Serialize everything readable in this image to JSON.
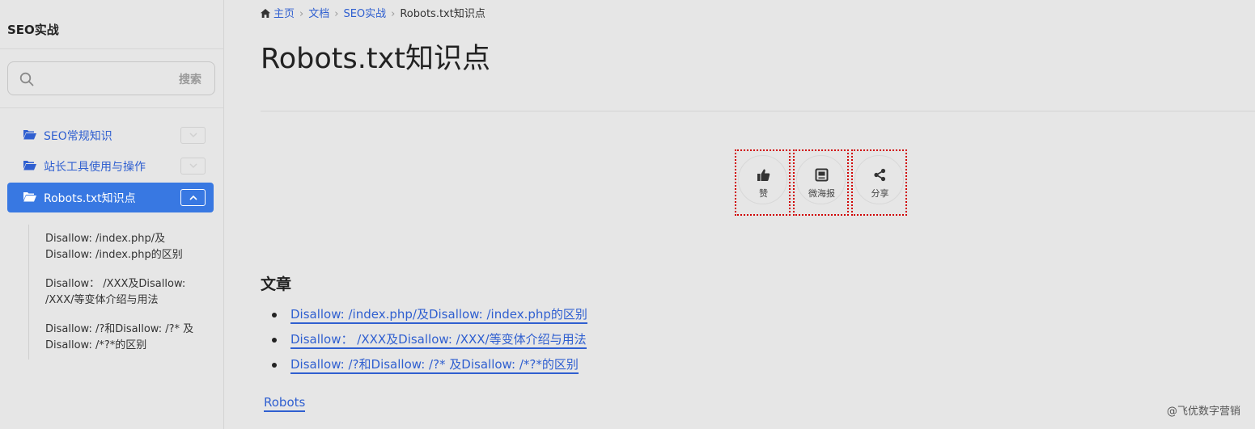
{
  "sidebar": {
    "title": "SEO实战",
    "search": {
      "placeholder": "",
      "button_label": "搜索"
    },
    "items": [
      {
        "label": "SEO常规知识",
        "icon": "folder-open-icon",
        "expanded": false
      },
      {
        "label": "站长工具使用与操作",
        "icon": "folder-open-icon",
        "expanded": false
      },
      {
        "label": "Robots.txt知识点",
        "icon": "folder-open-icon",
        "expanded": true
      }
    ],
    "subitems": [
      {
        "line1": "Disallow: /index.php/及",
        "line2": "Disallow: /index.php的区别"
      },
      {
        "line1": "Disallow： /XXX及Disallow:",
        "line2": "/XXX/等变体介绍与用法"
      },
      {
        "line1": "Disallow: /?和Disallow: /?* 及",
        "line2": "Disallow: /*?*的区别"
      }
    ]
  },
  "breadcrumb": {
    "home": "主页",
    "docs": "文档",
    "section": "SEO实战",
    "current": "Robots.txt知识点"
  },
  "page": {
    "title": "Robots.txt知识点"
  },
  "actions": [
    {
      "label": "赞",
      "icon": "thumbs-up-icon"
    },
    {
      "label": "微海报",
      "icon": "poster-icon"
    },
    {
      "label": "分享",
      "icon": "share-icon"
    }
  ],
  "articles": {
    "heading": "文章",
    "items": [
      "Disallow: /index.php/及Disallow: /index.php的区别",
      "Disallow： /XXX及Disallow: /XXX/等变体介绍与用法",
      "Disallow: /?和Disallow: /?* 及Disallow: /*?*的区别"
    ]
  },
  "tag": "Robots",
  "watermark": "@飞优数字营销",
  "colors": {
    "accent": "#3878e2",
    "link": "#2f5fd0",
    "background": "#e6e6e6",
    "highlight_border": "#d00000"
  }
}
